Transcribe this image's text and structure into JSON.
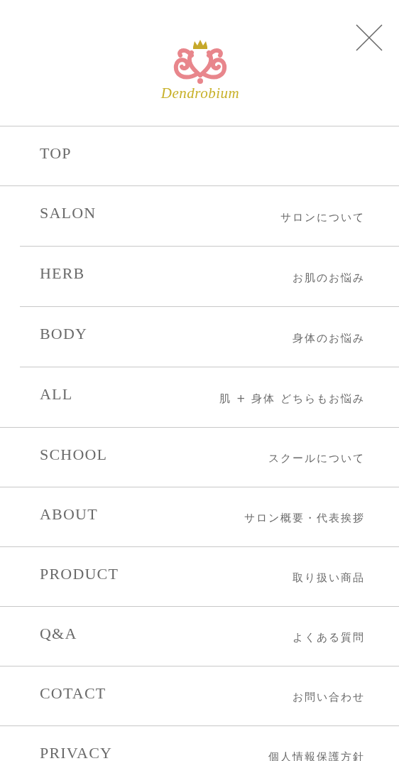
{
  "logo": {
    "text": "Dendrobium"
  },
  "menu": [
    {
      "label": "TOP"
    },
    {
      "label": "SALON",
      "sub": "サロンについて",
      "children": [
        {
          "label": "HERB",
          "sub": "お肌のお悩み"
        },
        {
          "label": "BODY",
          "sub": "身体のお悩み"
        },
        {
          "label": "ALL",
          "sub": "肌 + 身体 どちらもお悩み"
        }
      ]
    },
    {
      "label": "SCHOOL",
      "sub": "スクールについて"
    },
    {
      "label": "ABOUT",
      "sub": "サロン概要・代表挨拶"
    },
    {
      "label": "PRODUCT",
      "sub": "取り扱い商品"
    },
    {
      "label": "Q&A",
      "sub": "よくある質問"
    },
    {
      "label": "COTACT",
      "sub": "お問い合わせ"
    },
    {
      "label": "PRIVACY",
      "sub": "個人情報保護方針"
    }
  ]
}
